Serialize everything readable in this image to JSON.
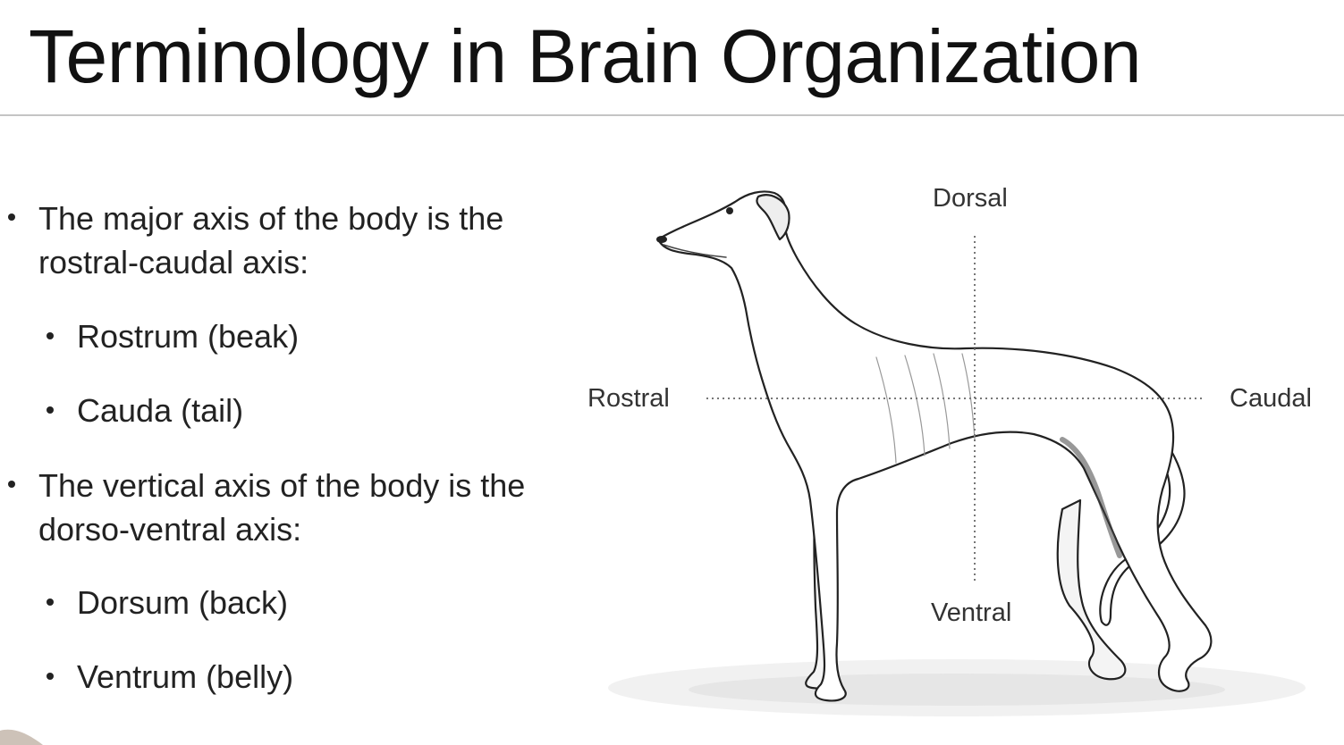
{
  "slide": {
    "title": "Terminology in Brain Organization"
  },
  "bullets": [
    {
      "level": 1,
      "text": "The major axis of the body is the rostral-caudal axis:"
    },
    {
      "level": 2,
      "text": "Rostrum (beak)"
    },
    {
      "level": 2,
      "text": "Cauda (tail)"
    },
    {
      "level": 1,
      "text": "The vertical axis of the body is the dorso-ventral axis:"
    },
    {
      "level": 2,
      "text": "Dorsum (back)"
    },
    {
      "level": 2,
      "text": "Ventrum (belly)"
    }
  ],
  "figure": {
    "labels": {
      "dorsal": "Dorsal",
      "ventral": "Ventral",
      "rostral": "Rostral",
      "caudal": "Caudal"
    }
  },
  "colors": {
    "text": "#222222",
    "rule": "#c4c4c4",
    "axis_line": "#888888",
    "drawing": "#222222"
  }
}
